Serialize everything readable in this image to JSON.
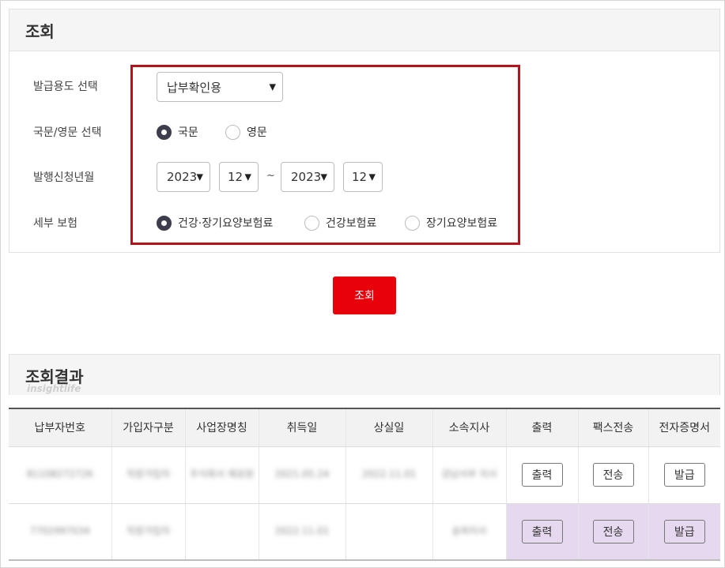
{
  "search_panel": {
    "title": "조회",
    "labels": {
      "purpose": "발급용도 선택",
      "language": "국문/영문 선택",
      "period": "발행신청년월",
      "insurance": "세부 보험"
    },
    "purpose_select": {
      "value": "납부확인용"
    },
    "language_options": [
      {
        "label": "국문",
        "selected": true
      },
      {
        "label": "영문",
        "selected": false
      }
    ],
    "period": {
      "from_year": "2023",
      "from_month": "12",
      "separator": "~",
      "to_year": "2023",
      "to_month": "12"
    },
    "insurance_options": [
      {
        "label": "건강·장기요양보험료",
        "selected": true
      },
      {
        "label": "건강보험료",
        "selected": false
      },
      {
        "label": "장기요양보험료",
        "selected": false
      }
    ],
    "highlight_color": "#b5121b"
  },
  "search_button": {
    "label": "조회",
    "color": "#e8000b"
  },
  "results": {
    "title": "조회결과",
    "watermark": "insightlife",
    "columns": [
      "납부자번호",
      "가입자구분",
      "사업장명칭",
      "취득일",
      "상실일",
      "소속지사",
      "출력",
      "팩스전송",
      "전자증명서"
    ],
    "rows": [
      {
        "payer_no": "81108272726",
        "member_type": "직장가입자",
        "workplace": "주식회사 제로원",
        "acquired": "2021.05.24",
        "lost": "2022.11.01",
        "branch": "강남서부 지사",
        "print": "출력",
        "fax": "전송",
        "cert": "발급",
        "highlight": false
      },
      {
        "payer_no": "7702997034",
        "member_type": "직장가입자",
        "workplace": "",
        "acquired": "2022.11.01",
        "lost": "",
        "branch": "송파지사",
        "print": "출력",
        "fax": "전송",
        "cert": "발급",
        "highlight": true
      }
    ],
    "highlight_color": "#e6d8ef"
  }
}
